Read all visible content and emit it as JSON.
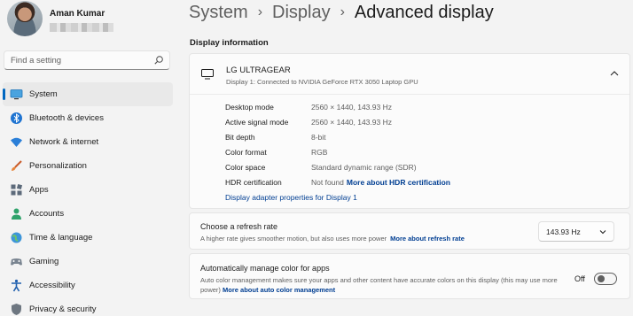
{
  "profile": {
    "name": "Aman Kumar"
  },
  "search": {
    "placeholder": "Find a setting"
  },
  "sidebar": {
    "items": [
      {
        "label": "System",
        "icon": "system-icon",
        "active": true
      },
      {
        "label": "Bluetooth & devices",
        "icon": "bluetooth-icon"
      },
      {
        "label": "Network & internet",
        "icon": "wifi-icon"
      },
      {
        "label": "Personalization",
        "icon": "brush-icon"
      },
      {
        "label": "Apps",
        "icon": "apps-icon"
      },
      {
        "label": "Accounts",
        "icon": "accounts-icon"
      },
      {
        "label": "Time & language",
        "icon": "globe-icon"
      },
      {
        "label": "Gaming",
        "icon": "gamepad-icon"
      },
      {
        "label": "Accessibility",
        "icon": "accessibility-icon"
      },
      {
        "label": "Privacy & security",
        "icon": "shield-icon"
      }
    ]
  },
  "breadcrumb": {
    "items": [
      "System",
      "Display"
    ],
    "separator": "›",
    "current": "Advanced display"
  },
  "display_info": {
    "section_title": "Display information",
    "monitor_name": "LG ULTRAGEAR",
    "monitor_subtitle": "Display 1: Connected to NVIDIA GeForce RTX 3050 Laptop GPU",
    "specs": [
      {
        "label": "Desktop mode",
        "value": "2560 × 1440, 143.93 Hz"
      },
      {
        "label": "Active signal mode",
        "value": "2560 × 1440, 143.93 Hz"
      },
      {
        "label": "Bit depth",
        "value": "8-bit"
      },
      {
        "label": "Color format",
        "value": "RGB"
      },
      {
        "label": "Color space",
        "value": "Standard dynamic range (SDR)"
      },
      {
        "label": "HDR certification",
        "value": "Not found",
        "link": "More about HDR certification"
      }
    ],
    "adapter_link": "Display adapter properties for Display 1"
  },
  "refresh_rate": {
    "title": "Choose a refresh rate",
    "description": "A higher rate gives smoother motion, but also uses more power",
    "link": "More about refresh rate",
    "selected": "143.93 Hz"
  },
  "auto_color": {
    "title": "Automatically manage color for apps",
    "description": "Auto color management makes sure your apps and other content have accurate colors on this display (this may use more power)",
    "link": "More about auto color management",
    "toggle_label": "Off",
    "toggle_state": false
  },
  "colors": {
    "accent": "#0067c0",
    "link": "#003e92",
    "background": "#f3f3f3",
    "card": "#fbfbfb"
  }
}
